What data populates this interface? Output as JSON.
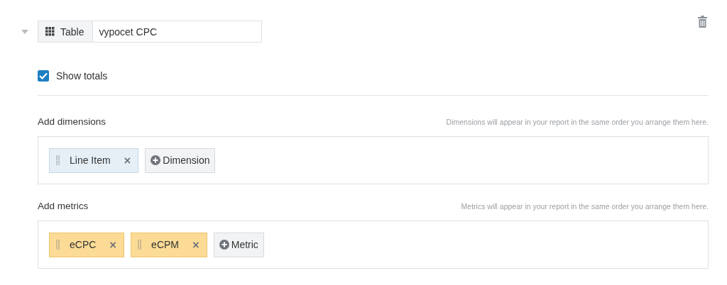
{
  "widget": {
    "expanded": true,
    "type_label": "Table",
    "name": "vypocet CPC"
  },
  "show_totals": {
    "label": "Show totals",
    "checked": true
  },
  "sections": [
    {
      "kind": "dimension",
      "title": "Add dimensions",
      "hint": "Dimensions will appear in your report in the same order you arrange them here.",
      "chips": [
        {
          "label": "Line Item",
          "remove": "×"
        }
      ],
      "add_label": "Dimension"
    },
    {
      "kind": "metric",
      "title": "Add metrics",
      "hint": "Metrics will appear in your report in the same order you arrange them here.",
      "chips": [
        {
          "label": "eCPC",
          "remove": "×"
        },
        {
          "label": "eCPM",
          "remove": "×"
        }
      ],
      "add_label": "Metric"
    }
  ]
}
